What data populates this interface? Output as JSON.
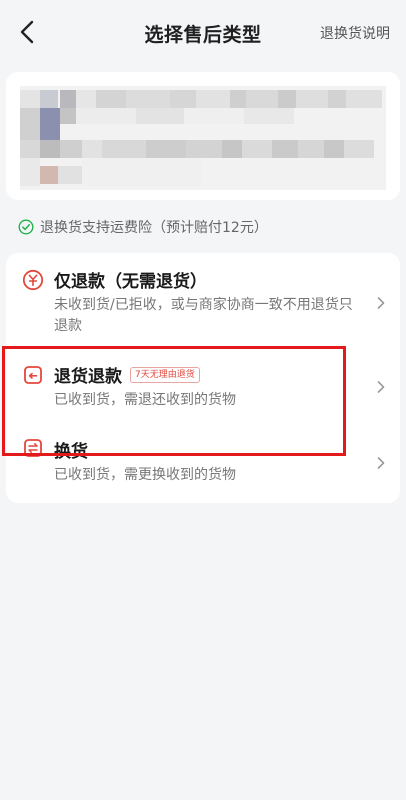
{
  "header": {
    "title": "选择售后类型",
    "help_link": "退换货说明",
    "back_icon": "chevron-left-icon"
  },
  "insurance": {
    "text": "退换货支持运费险（预计赔付12元）",
    "icon": "check-circle-icon",
    "color": "#22b14c"
  },
  "options": [
    {
      "title": "仅退款（无需退货）",
      "desc": "未收到货/已拒收，或与商家协商一致不用退货只退款",
      "icon": "yen-circle-icon",
      "badge": ""
    },
    {
      "title": "退货退款",
      "desc": "已收到货，需退还收到的货物",
      "icon": "return-box-icon",
      "badge": "7天无理由退货"
    },
    {
      "title": "换货",
      "desc": "已收到货，需更换收到的货物",
      "icon": "exchange-icon",
      "badge": ""
    }
  ],
  "colors": {
    "accent": "#e2483d",
    "highlight": "#e3191b",
    "background": "#f4f5f7"
  }
}
